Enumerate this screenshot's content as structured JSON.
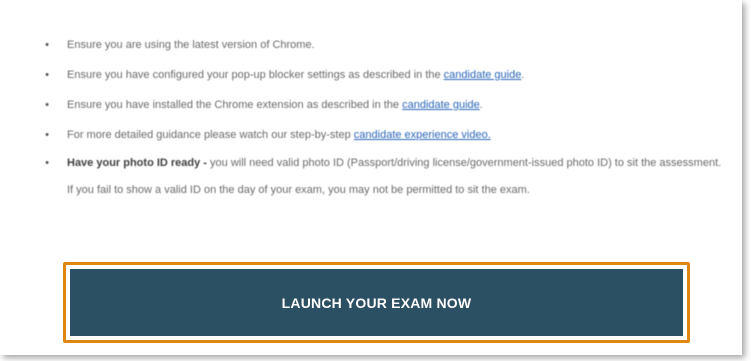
{
  "instructions": [
    {
      "text": "Ensure you are using the latest version of Chrome."
    },
    {
      "text": "Ensure you have configured your pop-up blocker settings as described in the ",
      "link": "candidate guide",
      "after": "."
    },
    {
      "text": "Ensure you have installed the Chrome extension as described in the ",
      "link": "candidate guide",
      "after": "."
    },
    {
      "text": "For more detailed guidance please watch our step-by-step ",
      "link": "candidate experience video."
    },
    {
      "bold": "Have your photo ID ready -",
      "text": " you will need valid photo ID (Passport/driving license/government-issued photo ID) to sit the assessment. If you fail to show a valid ID on the day of your exam, you may not be permitted to sit the exam."
    }
  ],
  "bullet_glyph": "•",
  "launch_button": {
    "label": "LAUNCH YOUR EXAM NOW"
  },
  "colors": {
    "button_background": "#2b4f63",
    "button_outline": "#e08712",
    "link": "#2a66b8"
  }
}
